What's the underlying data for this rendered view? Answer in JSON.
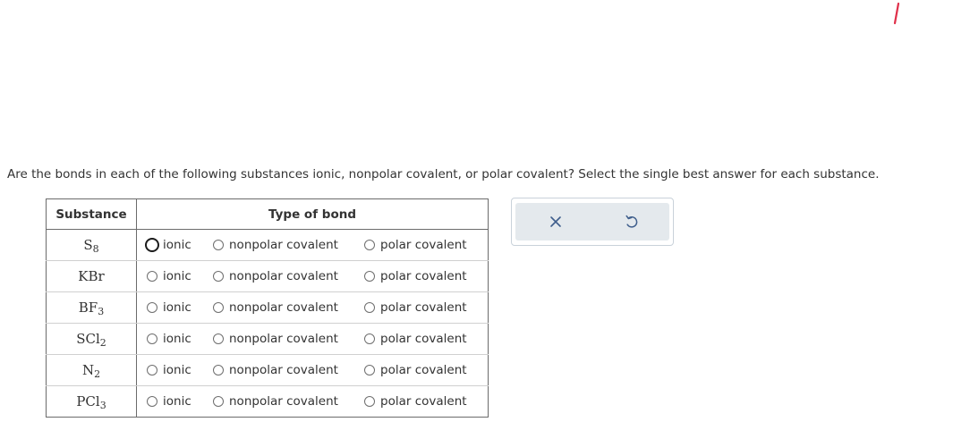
{
  "question": "Are the bonds in each of the following substances ionic, nonpolar covalent, or polar covalent? Select the single best answer for each substance.",
  "table": {
    "header_substance": "Substance",
    "header_type": "Type of bond",
    "options": [
      "ionic",
      "nonpolar covalent",
      "polar covalent"
    ],
    "rows": [
      {
        "base": "S",
        "sub": "8",
        "selected": null,
        "focused": "ionic"
      },
      {
        "base": "KBr",
        "sub": "",
        "selected": null
      },
      {
        "base": "BF",
        "sub": "3",
        "selected": null
      },
      {
        "base": "SCl",
        "sub": "2",
        "selected": null
      },
      {
        "base": "N",
        "sub": "2",
        "selected": null
      },
      {
        "base": "PCl",
        "sub": "3",
        "selected": null
      }
    ]
  },
  "toolbar": {
    "icons": [
      "close-icon",
      "undo-icon"
    ]
  },
  "colors": {
    "accent_mark": "#e0304a",
    "toolbar_bg": "#e4e9ed",
    "icon": "#3f5e8c"
  }
}
